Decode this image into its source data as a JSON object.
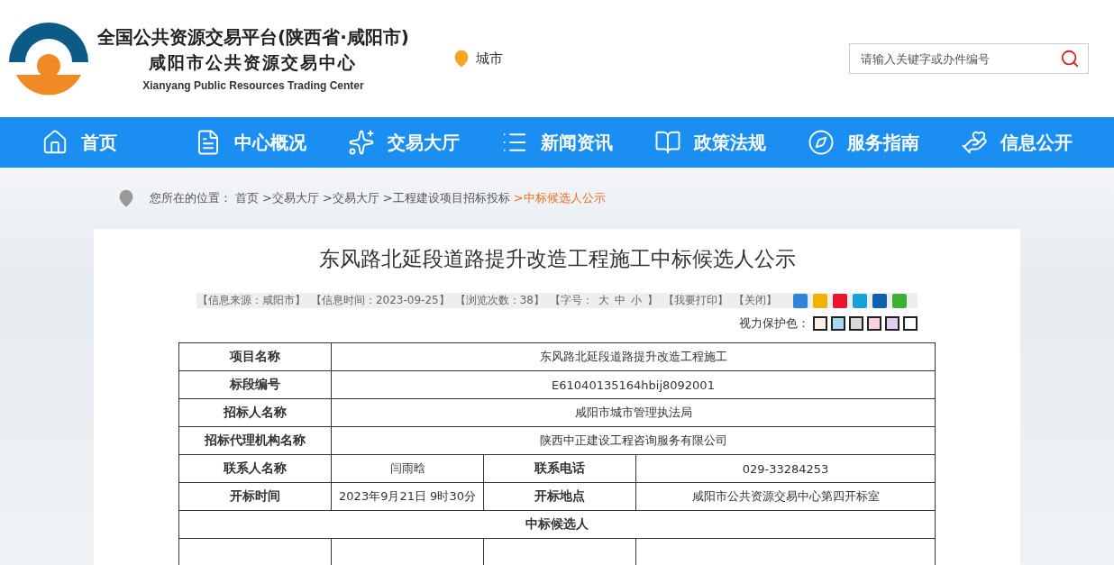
{
  "header": {
    "title_cn": "全国公共资源交易平台(陕西省·咸阳市)",
    "subtitle_cn": "咸阳市公共资源交易中心",
    "subtitle_en": "Xianyang Public Resources Trading Center",
    "location": "城市",
    "search": {
      "placeholder": "请输入关键字或办件编号"
    }
  },
  "nav": [
    {
      "label": "首页",
      "kind": "home"
    },
    {
      "label": "中心概况",
      "kind": "doc"
    },
    {
      "label": "交易大厅",
      "kind": "star"
    },
    {
      "label": "新闻资讯",
      "kind": "list"
    },
    {
      "label": "政策法规",
      "kind": "book"
    },
    {
      "label": "服务指南",
      "kind": "compass"
    },
    {
      "label": "信息公开",
      "kind": "hand"
    }
  ],
  "breadcrumb": {
    "label": "您所在的位置：",
    "items": [
      {
        "text": "首页",
        "current": false
      },
      {
        "text": ">交易大厅",
        "current": false
      },
      {
        "text": ">交易大厅",
        "current": false
      },
      {
        "text": ">工程建设项目招标投标",
        "current": false
      },
      {
        "text": ">中标候选人公示",
        "current": true
      }
    ]
  },
  "article": {
    "title": "东风路北延段道路提升改造工程施工中标候选人公示",
    "meta": [
      "【信息来源：咸阳市】",
      "【信息时间：2023-09-25】",
      "【浏览次数：38】"
    ],
    "font_size": {
      "label": "【字号：",
      "options": [
        "大",
        "中",
        "小"
      ],
      "end": "】"
    },
    "actions": [
      "【我要打印】",
      "【关闭】"
    ],
    "share": [
      {
        "color": "#2f86d8"
      },
      {
        "color": "#f0b400"
      },
      {
        "color": "#e6162d"
      },
      {
        "color": "#1aa0d8"
      },
      {
        "color": "#1060b0"
      },
      {
        "color": "#3cb034"
      }
    ],
    "eye_care": {
      "label": "视力保护色：",
      "colors": [
        {
          "color": "#f7f1ea"
        },
        {
          "color": "#a7d9ee"
        },
        {
          "color": "#d9d9d9"
        },
        {
          "color": "#f6d3dc"
        },
        {
          "color": "#e1cdf3"
        },
        {
          "color": "#ffffff"
        }
      ]
    },
    "table": {
      "rows": [
        {
          "kind": "wide",
          "cells": [
            "项目名称",
            {
              "text": "东风路北延段道路提升改造工程施工",
              "colspan": 3
            }
          ]
        },
        {
          "kind": "wide",
          "cells": [
            "标段编号",
            {
              "text": "E61040135164hbij8092001",
              "colspan": 3
            }
          ]
        },
        {
          "kind": "wide",
          "cells": [
            "招标人名称",
            {
              "text": "咸阳市城市管理执法局",
              "colspan": 3
            }
          ]
        },
        {
          "kind": "wide",
          "cells": [
            "招标代理机构名称",
            {
              "text": "陕西中正建设工程咨询服务有限公司",
              "colspan": 3
            }
          ]
        },
        {
          "kind": "pair",
          "cells": [
            "联系人名称",
            "闫雨晗",
            "联系电话",
            "029-33284253"
          ]
        },
        {
          "kind": "pair",
          "cells": [
            "开标时间",
            "2023年9月21日 9时30分",
            "开标地点",
            "咸阳市公共资源交易中心第四开标室"
          ]
        },
        {
          "kind": "section",
          "cells": [
            {
              "text": "中标候选人",
              "colspan": 4
            }
          ]
        }
      ]
    }
  }
}
